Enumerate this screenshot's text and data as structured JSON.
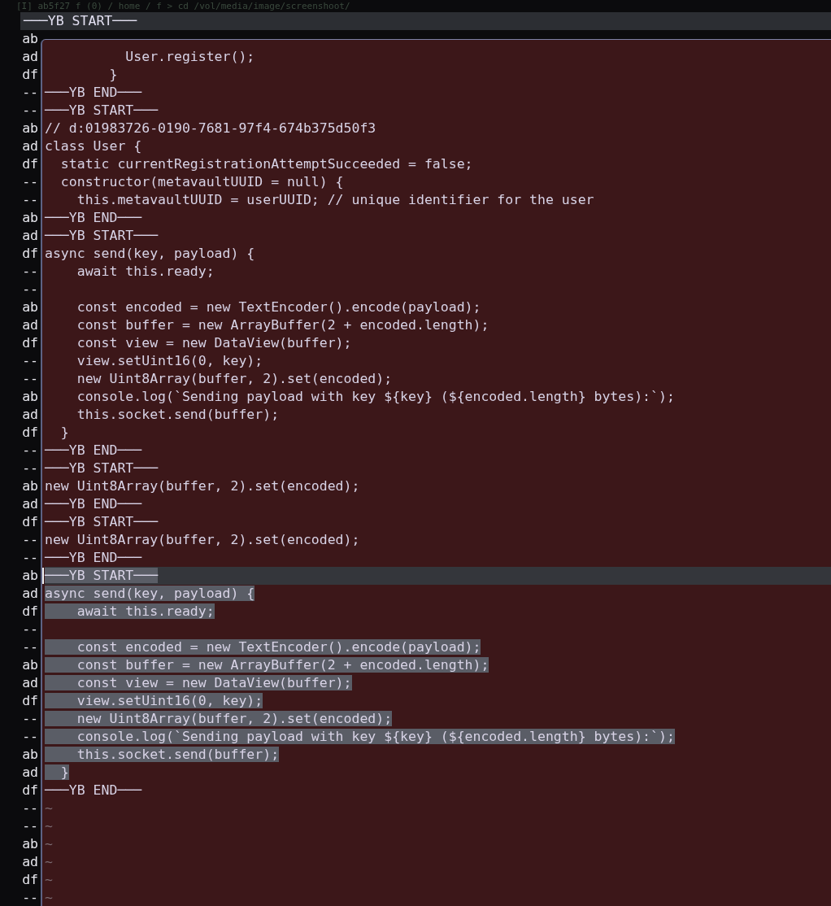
{
  "background_prompt": "[I] ab5f27 f (0) / home / f > cd /vol/media/image/screenshoot/",
  "header": {
    "title": "───YB START───"
  },
  "gutter": [
    "ab",
    "ad",
    "df",
    "--",
    "--",
    "ab",
    "ad",
    "df",
    "--",
    "--",
    "ab",
    "ad",
    "df",
    "--",
    "--",
    "ab",
    "ad",
    "df",
    "--",
    "--",
    "ab",
    "ad",
    "df",
    "--",
    "--",
    "ab",
    "ad",
    "df",
    "--",
    "--",
    "ab",
    "ad",
    "df",
    "--",
    "--",
    "ab",
    "ad",
    "df",
    "--",
    "--",
    "ab",
    "ad",
    "df",
    "--",
    "--",
    "ab",
    "ad",
    "df",
    "--"
  ],
  "editor": {
    "lines": [
      {
        "kind": "code",
        "text": "          User.register();",
        "selected": false,
        "cursor": false
      },
      {
        "kind": "code",
        "text": "        }",
        "selected": false,
        "cursor": false
      },
      {
        "kind": "code",
        "text": "───YB END───",
        "selected": false,
        "cursor": false
      },
      {
        "kind": "code",
        "text": "───YB START───",
        "selected": false,
        "cursor": false
      },
      {
        "kind": "code",
        "text": "// d:01983726-0190-7681-97f4-674b375d50f3",
        "selected": false,
        "cursor": false
      },
      {
        "kind": "code",
        "text": "class User {",
        "selected": false,
        "cursor": false
      },
      {
        "kind": "code",
        "text": "  static currentRegistrationAttemptSucceeded = false;",
        "selected": false,
        "cursor": false
      },
      {
        "kind": "code",
        "text": "  constructor(metavaultUUID = null) {",
        "selected": false,
        "cursor": false
      },
      {
        "kind": "code",
        "text": "    this.metavaultUUID = userUUID; // unique identifier for the user",
        "selected": false,
        "cursor": false
      },
      {
        "kind": "code",
        "text": "───YB END───",
        "selected": false,
        "cursor": false
      },
      {
        "kind": "code",
        "text": "───YB START───",
        "selected": false,
        "cursor": false
      },
      {
        "kind": "code",
        "text": "async send(key, payload) {",
        "selected": false,
        "cursor": false
      },
      {
        "kind": "code",
        "text": "    await this.ready;",
        "selected": false,
        "cursor": false
      },
      {
        "kind": "blank"
      },
      {
        "kind": "code",
        "text": "    const encoded = new TextEncoder().encode(payload);",
        "selected": false,
        "cursor": false
      },
      {
        "kind": "code",
        "text": "    const buffer = new ArrayBuffer(2 + encoded.length);",
        "selected": false,
        "cursor": false
      },
      {
        "kind": "code",
        "text": "    const view = new DataView(buffer);",
        "selected": false,
        "cursor": false
      },
      {
        "kind": "code",
        "text": "    view.setUint16(0, key);",
        "selected": false,
        "cursor": false
      },
      {
        "kind": "code",
        "text": "    new Uint8Array(buffer, 2).set(encoded);",
        "selected": false,
        "cursor": false
      },
      {
        "kind": "code",
        "text": "    console.log(`Sending payload with key ${key} (${encoded.length} bytes):`);",
        "selected": false,
        "cursor": false
      },
      {
        "kind": "code",
        "text": "    this.socket.send(buffer);",
        "selected": false,
        "cursor": false
      },
      {
        "kind": "code",
        "text": "  }",
        "selected": false,
        "cursor": false
      },
      {
        "kind": "code",
        "text": "───YB END───",
        "selected": false,
        "cursor": false
      },
      {
        "kind": "code",
        "text": "───YB START───",
        "selected": false,
        "cursor": false
      },
      {
        "kind": "code",
        "text": "new Uint8Array(buffer, 2).set(encoded);",
        "selected": false,
        "cursor": false
      },
      {
        "kind": "code",
        "text": "───YB END───",
        "selected": false,
        "cursor": false
      },
      {
        "kind": "code",
        "text": "───YB START───",
        "selected": false,
        "cursor": false
      },
      {
        "kind": "code",
        "text": "new Uint8Array(buffer, 2).set(encoded);",
        "selected": false,
        "cursor": false
      },
      {
        "kind": "code",
        "text": "───YB END───",
        "selected": false,
        "cursor": false
      },
      {
        "kind": "code",
        "text": "───YB START───",
        "selected": true,
        "cursor": true
      },
      {
        "kind": "code",
        "text": "async send(key, payload) {",
        "selected": true,
        "cursor": false
      },
      {
        "kind": "code",
        "text": "    await this.ready;",
        "selected": true,
        "cursor": false
      },
      {
        "kind": "blank"
      },
      {
        "kind": "code",
        "text": "    const encoded = new TextEncoder().encode(payload);",
        "selected": true,
        "cursor": false
      },
      {
        "kind": "code",
        "text": "    const buffer = new ArrayBuffer(2 + encoded.length);",
        "selected": true,
        "cursor": false
      },
      {
        "kind": "code",
        "text": "    const view = new DataView(buffer);",
        "selected": true,
        "cursor": false
      },
      {
        "kind": "code",
        "text": "    view.setUint16(0, key);",
        "selected": true,
        "cursor": false
      },
      {
        "kind": "code",
        "text": "    new Uint8Array(buffer, 2).set(encoded);",
        "selected": true,
        "cursor": false
      },
      {
        "kind": "code",
        "text": "    console.log(`Sending payload with key ${key} (${encoded.length} bytes):`);",
        "selected": true,
        "cursor": false
      },
      {
        "kind": "code",
        "text": "    this.socket.send(buffer);",
        "selected": true,
        "cursor": false
      },
      {
        "kind": "code",
        "text": "  }",
        "selected": true,
        "cursor": false
      },
      {
        "kind": "code",
        "text": "───YB END───",
        "selected": false,
        "cursor": false
      },
      {
        "kind": "tilde",
        "text": "~"
      },
      {
        "kind": "tilde",
        "text": "~"
      },
      {
        "kind": "tilde",
        "text": "~"
      },
      {
        "kind": "tilde",
        "text": "~"
      },
      {
        "kind": "tilde",
        "text": "~"
      },
      {
        "kind": "tilde",
        "text": "~"
      }
    ]
  }
}
